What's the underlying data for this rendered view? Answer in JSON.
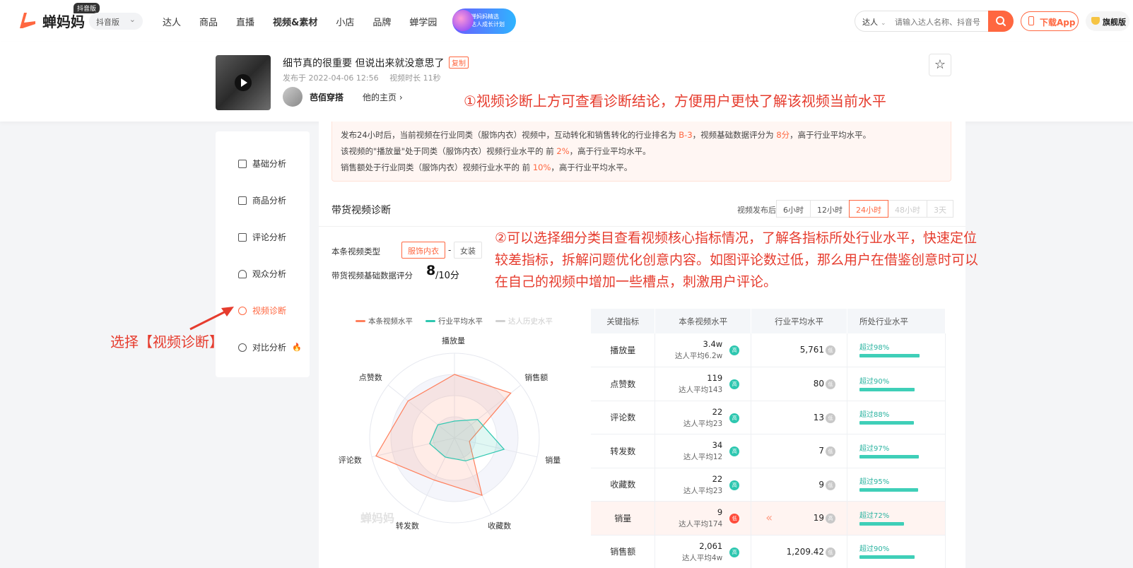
{
  "nav": {
    "logo_text": "蝉妈妈",
    "edition_tag": "抖音版",
    "edition_select": "抖音版",
    "items": [
      "达人",
      "商品",
      "直播",
      "视频&素材",
      "小店",
      "品牌",
      "蝉学园"
    ],
    "promo_line1": "蝉妈妈精选",
    "promo_line2": "达人成长计划",
    "search_type": "达人",
    "search_placeholder": "请输入达人名称、抖音号",
    "download_label": "下载App",
    "flagship_label": "旗舰版"
  },
  "video": {
    "title": "细节真的很重要 但说出来就没意思了",
    "copy_label": "复制",
    "published": "发布于 2022-04-06 12:56",
    "duration": "视频时长 11秒",
    "author": "芭佰穿搭",
    "home_link": "他的主页 ›"
  },
  "annotations": {
    "a1": "①视频诊断上方可查看诊断结论，方便用户更快了解该视频当前水平",
    "a2": "②可以选择细分类目查看视频核心指标情况，了解各指标所处行业水平，快速定位较差指标，拆解问题优化创意内容。如图评论数过低，那么用户在借鉴创意时可以在自己的视频中增加一些槽点，刺激用户评论。",
    "select": "选择【视频诊断】"
  },
  "sidebar": {
    "items": [
      {
        "label": "基础分析"
      },
      {
        "label": "商品分析"
      },
      {
        "label": "评论分析"
      },
      {
        "label": "观众分析"
      },
      {
        "label": "视频诊断"
      },
      {
        "label": "对比分析"
      }
    ],
    "active_index": 4
  },
  "conclusion": {
    "l1_a": "发布24小时后，当前视频在行业同类（服饰内衣）视频中，互动转化和销售转化的行业排名为",
    "l1_rank": "B-3",
    "l1_b": "，视频基础数据评分为",
    "l1_score": "8分",
    "l1_c": "，高于行业平均水平。",
    "l2_a": "该视频的\"播放量\"处于同类（服饰内衣）视频行业水平的 前",
    "l2_pct": "2%",
    "l2_b": "，高于行业平均水平。",
    "l3_a": "销售额处于行业同类（服饰内衣）视频行业水平的 前",
    "l3_pct": "10%",
    "l3_b": "，高于行业平均水平。"
  },
  "diagnosis": {
    "title": "带货视频诊断",
    "time_label": "视频发布后",
    "time_tabs": [
      "6小时",
      "12小时",
      "24小时",
      "48小时",
      "3天"
    ],
    "active_tab": 2,
    "type_label": "本条视频类型",
    "type_primary": "服饰内衣",
    "type_dash": "-",
    "type_secondary": "女装",
    "score_label": "带货视频基础数据评分",
    "score_value": "8",
    "score_total": "/10分"
  },
  "legend": {
    "this_video": "本条视频水平",
    "industry": "行业平均水平",
    "history": "达人历史水平"
  },
  "colors": {
    "accent": "#ff6740",
    "this_video": "#ff7f5c",
    "industry": "#2ec7b0",
    "history": "#d0d0d0",
    "annotation": "#e63c2e"
  },
  "chart_data": {
    "type": "radar",
    "axes": [
      "播放量",
      "销售额",
      "销量",
      "收藏数",
      "转发数",
      "评论数",
      "点赞数"
    ],
    "series": [
      {
        "name": "本条视频水平",
        "values": [
          0.75,
          0.85,
          0.18,
          0.75,
          0.55,
          0.95,
          0.7
        ]
      },
      {
        "name": "行业平均水平",
        "values": [
          0.2,
          0.35,
          0.6,
          0.3,
          0.25,
          0.3,
          0.25
        ]
      }
    ],
    "range": [
      0,
      1
    ]
  },
  "watermark": "蝉妈妈",
  "table": {
    "headers": [
      "关键指标",
      "本条视频水平",
      "行业平均水平",
      "所处行业水平"
    ],
    "rows": [
      {
        "name": "播放量",
        "value": "3.4w",
        "avg": "达人平均6.2w",
        "badge": "高",
        "badge_type": "high",
        "industry": "5,761",
        "ind_badge": "低",
        "level": "超过98%",
        "pct": 98,
        "low": false
      },
      {
        "name": "点赞数",
        "value": "119",
        "avg": "达人平均143",
        "badge": "高",
        "badge_type": "high",
        "industry": "80",
        "ind_badge": "低",
        "level": "超过90%",
        "pct": 90,
        "low": false
      },
      {
        "name": "评论数",
        "value": "22",
        "avg": "达人平均23",
        "badge": "高",
        "badge_type": "high",
        "industry": "13",
        "ind_badge": "低",
        "level": "超过88%",
        "pct": 88,
        "low": false
      },
      {
        "name": "转发数",
        "value": "34",
        "avg": "达人平均12",
        "badge": "高",
        "badge_type": "high",
        "industry": "7",
        "ind_badge": "低",
        "level": "超过97%",
        "pct": 97,
        "low": false
      },
      {
        "name": "收藏数",
        "value": "22",
        "avg": "达人平均23",
        "badge": "高",
        "badge_type": "high",
        "industry": "9",
        "ind_badge": "低",
        "level": "超过95%",
        "pct": 95,
        "low": false
      },
      {
        "name": "销量",
        "value": "9",
        "avg": "达人平均174",
        "badge": "低",
        "badge_type": "low",
        "industry": "19",
        "ind_badge": "高",
        "level": "超过72%",
        "pct": 72,
        "low": true
      },
      {
        "name": "销售额",
        "value": "2,061",
        "avg": "达人平均4w",
        "badge": "高",
        "badge_type": "high",
        "industry": "1,209.42",
        "ind_badge": "低",
        "level": "超过90%",
        "pct": 90,
        "low": false
      }
    ]
  }
}
